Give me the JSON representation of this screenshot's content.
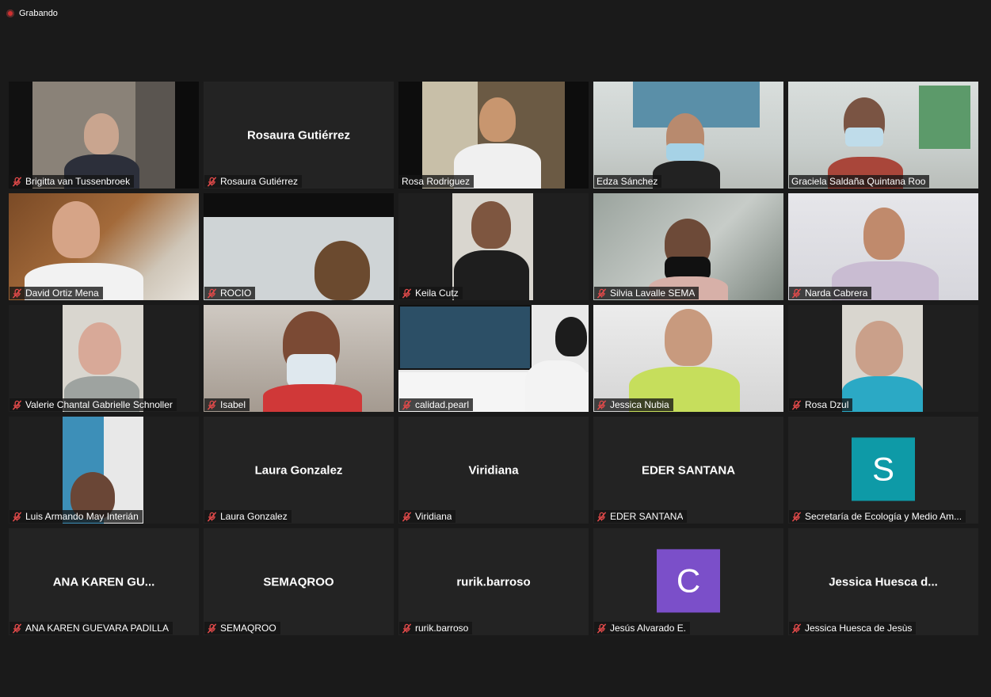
{
  "recording": {
    "label": "Grabando"
  },
  "colors": {
    "active_border": "#d8e26a",
    "mute_red": "#e24a4a",
    "avatar_teal": "#0e9aa7",
    "avatar_purple": "#7b4fc9"
  },
  "participants": [
    {
      "name": "Brigitta van Tussenbroek",
      "video": true
    },
    {
      "name": "Rosaura Gutiérrez",
      "video": false,
      "display": "Rosaura Gutiérrez"
    },
    {
      "name": "Rosa Rodriguez",
      "video": true
    },
    {
      "name": "Edza Sánchez",
      "video": true
    },
    {
      "name": "Graciela Saldaña Quintana Roo",
      "video": true,
      "active": true
    },
    {
      "name": "David Ortiz Mena",
      "video": true
    },
    {
      "name": "ROCIO",
      "video": true
    },
    {
      "name": "Keila Cutz",
      "video": true
    },
    {
      "name": "Silvia Lavalle SEMA",
      "video": true
    },
    {
      "name": "Narda Cabrera",
      "video": true
    },
    {
      "name": "Valerie Chantal Gabrielle Schnoller",
      "video": true
    },
    {
      "name": "Isabel",
      "video": true
    },
    {
      "name": "calidad.pearl",
      "video": true
    },
    {
      "name": "Jessica Nubia",
      "video": true
    },
    {
      "name": "Rosa Dzul",
      "video": true
    },
    {
      "name": "Luis Armando May Interián",
      "video": true
    },
    {
      "name": "Laura Gonzalez",
      "video": false,
      "display": "Laura Gonzalez"
    },
    {
      "name": "Viridiana",
      "video": false,
      "display": "Viridiana"
    },
    {
      "name": "EDER SANTANA",
      "video": false,
      "display": "EDER SANTANA"
    },
    {
      "name": "Secretaría de Ecología y Medio Am...",
      "video": false,
      "avatar": "S"
    },
    {
      "name": "ANA KAREN GUEVARA PADILLA",
      "video": false,
      "display": "ANA KAREN GU..."
    },
    {
      "name": "SEMAQROO",
      "video": false,
      "display": "SEMAQROO"
    },
    {
      "name": "rurik.barroso",
      "video": false,
      "display": "rurik.barroso"
    },
    {
      "name": "Jesús Alvarado E.",
      "video": false,
      "avatar": "C"
    },
    {
      "name": "Jessica Huesca de Jesùs",
      "video": false,
      "display": "Jessica Huesca d..."
    }
  ]
}
